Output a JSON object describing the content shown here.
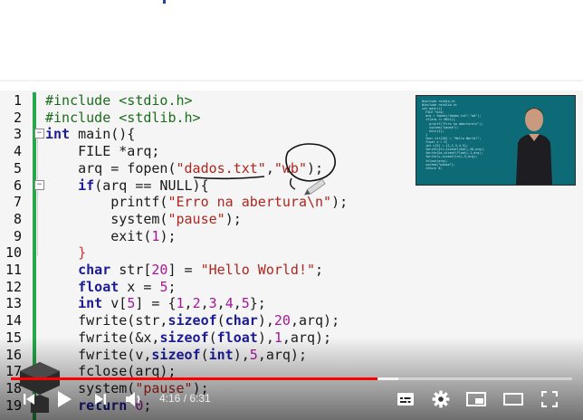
{
  "code": {
    "lines": [
      {
        "n": "1",
        "html": "<span class=\"pp\">#include &lt;stdio.h&gt;</span>"
      },
      {
        "n": "2",
        "html": "<span class=\"pp\">#include &lt;stdlib.h&gt;</span>"
      },
      {
        "n": "3",
        "html": "<span class=\"kw\">int</span> main(){"
      },
      {
        "n": "4",
        "html": "    FILE *arq;"
      },
      {
        "n": "5",
        "html": "    arq = fopen(<span class=\"str\">\"dados.txt\"</span>,<span class=\"str\">\"wb\"</span>);"
      },
      {
        "n": "6",
        "html": "    <span class=\"kw\">if</span>(arq == NULL){"
      },
      {
        "n": "7",
        "html": "        printf(<span class=\"str\">\"Erro na abertura\\n\"</span>);"
      },
      {
        "n": "8",
        "html": "        system(<span class=\"str\">\"pause\"</span>);"
      },
      {
        "n": "9",
        "html": "        exit(<span class=\"num\">1</span>);"
      },
      {
        "n": "10",
        "html": "    <span class=\"br\">}</span>"
      },
      {
        "n": "11",
        "html": "    <span class=\"kw\">char</span> str[<span class=\"num\">20</span>] = <span class=\"str\">\"Hello World!\"</span>;"
      },
      {
        "n": "12",
        "html": "    <span class=\"kw\">float</span> x = <span class=\"num\">5</span>;"
      },
      {
        "n": "13",
        "html": "    <span class=\"kw\">int</span> v[<span class=\"num\">5</span>] = {<span class=\"num\">1</span>,<span class=\"num\">2</span>,<span class=\"num\">3</span>,<span class=\"num\">4</span>,<span class=\"num\">5</span>};"
      },
      {
        "n": "14",
        "html": "    fwrite(str,<span class=\"kw\">sizeof</span>(<span class=\"kw\">char</span>),<span class=\"num\">20</span>,arq);"
      },
      {
        "n": "15",
        "html": "    fwrite(&amp;x,<span class=\"kw\">sizeof</span>(<span class=\"kw\">float</span>),<span class=\"num\">1</span>,arq);"
      },
      {
        "n": "16",
        "html": "    fwrite(v,<span class=\"kw\">sizeof</span>(<span class=\"kw\">int</span>),<span class=\"num\">5</span>,arq);"
      },
      {
        "n": "17",
        "html": "    fclose(arq);"
      },
      {
        "n": "18",
        "html": "    system(<span class=\"str\">\"pause\"</span>);"
      },
      {
        "n": "19",
        "html": "    <span class=\"kw\">return</span> <span class=\"num\">0</span>;"
      }
    ],
    "fold_lines": [
      "3",
      "6"
    ]
  },
  "player": {
    "time_current": "4:16",
    "time_separator": " / ",
    "time_total": "6:31",
    "progress_fraction": 0.654,
    "buffer_fraction": 0.69,
    "accent_color": "#ff0000"
  },
  "icons": {
    "previous": "skip-previous-icon",
    "play": "play-icon",
    "next": "skip-next-icon",
    "volume": "volume-icon",
    "subtitles": "subtitles-icon",
    "settings": "gear-icon",
    "miniplayer": "miniplayer-icon",
    "theater": "theater-mode-icon",
    "fullscreen": "fullscreen-icon"
  }
}
